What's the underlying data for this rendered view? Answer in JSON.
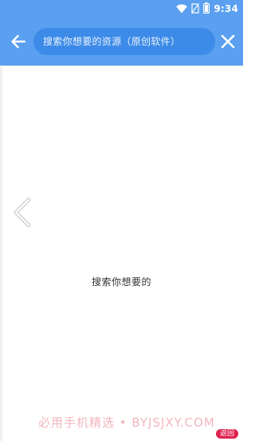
{
  "status_bar": {
    "time": "9:34",
    "icons": [
      "wifi-icon",
      "sim-off-icon",
      "battery-icon"
    ]
  },
  "header": {
    "back_icon": "arrow-left-icon",
    "search_placeholder": "搜索你想要的资源（原创软件）",
    "close_icon": "close-icon"
  },
  "content": {
    "empty_message": "搜索你想要的",
    "nav_icon": "chevron-left-icon"
  },
  "watermark": {
    "text": "必用手机精选 • BYJSJXY.COM"
  },
  "floating": {
    "return_label": "返回"
  },
  "colors": {
    "primary": "#5a9ff0",
    "search_box": "#3d8be8",
    "badge": "#e0204d"
  }
}
